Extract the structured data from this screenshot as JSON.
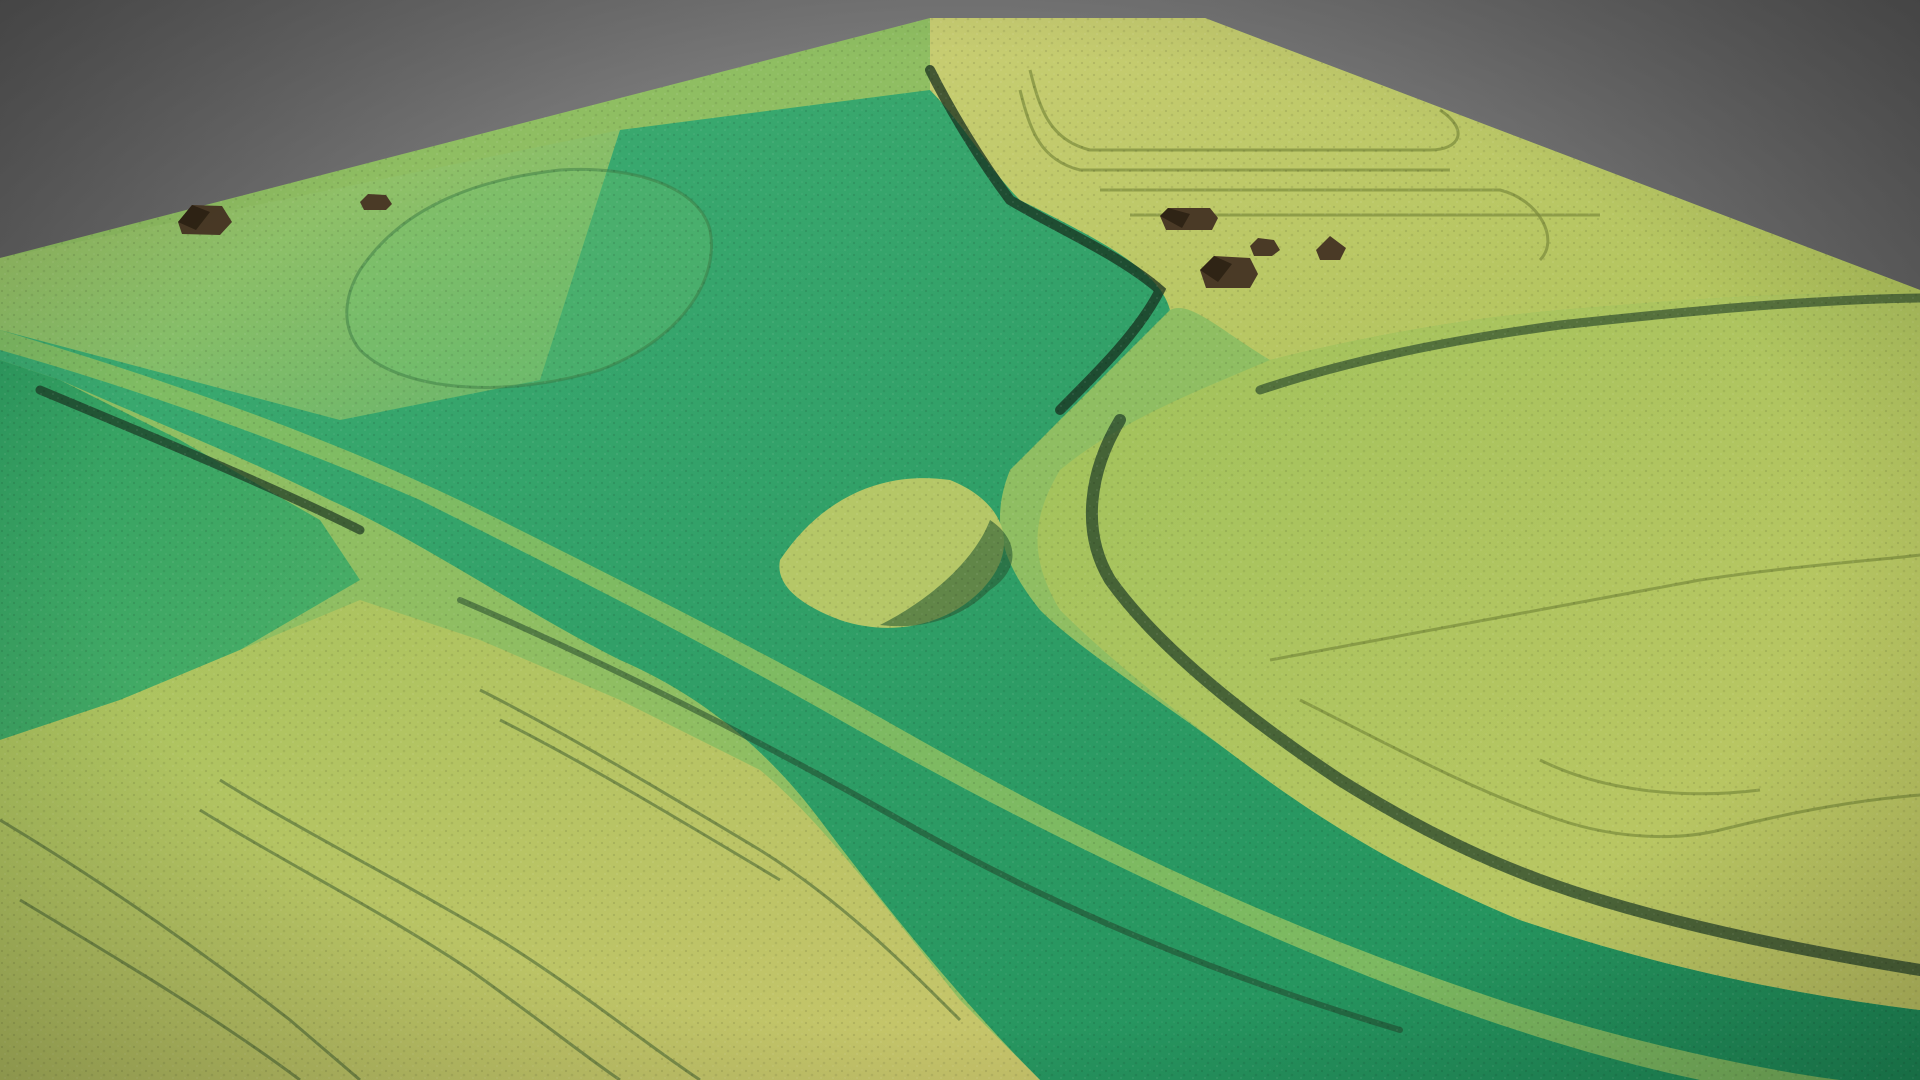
{
  "scene": {
    "kind": "3d-terrain-heightmap",
    "background_color": "#6f6f6f",
    "colors": {
      "low_green": "#1f9a5e",
      "mid_green": "#4fb169",
      "high_yellow": "#b9c65a",
      "pale_yellow": "#c9cd6d",
      "ridge_shadow": "#1d3b26",
      "building": "#3b2c1c"
    }
  }
}
